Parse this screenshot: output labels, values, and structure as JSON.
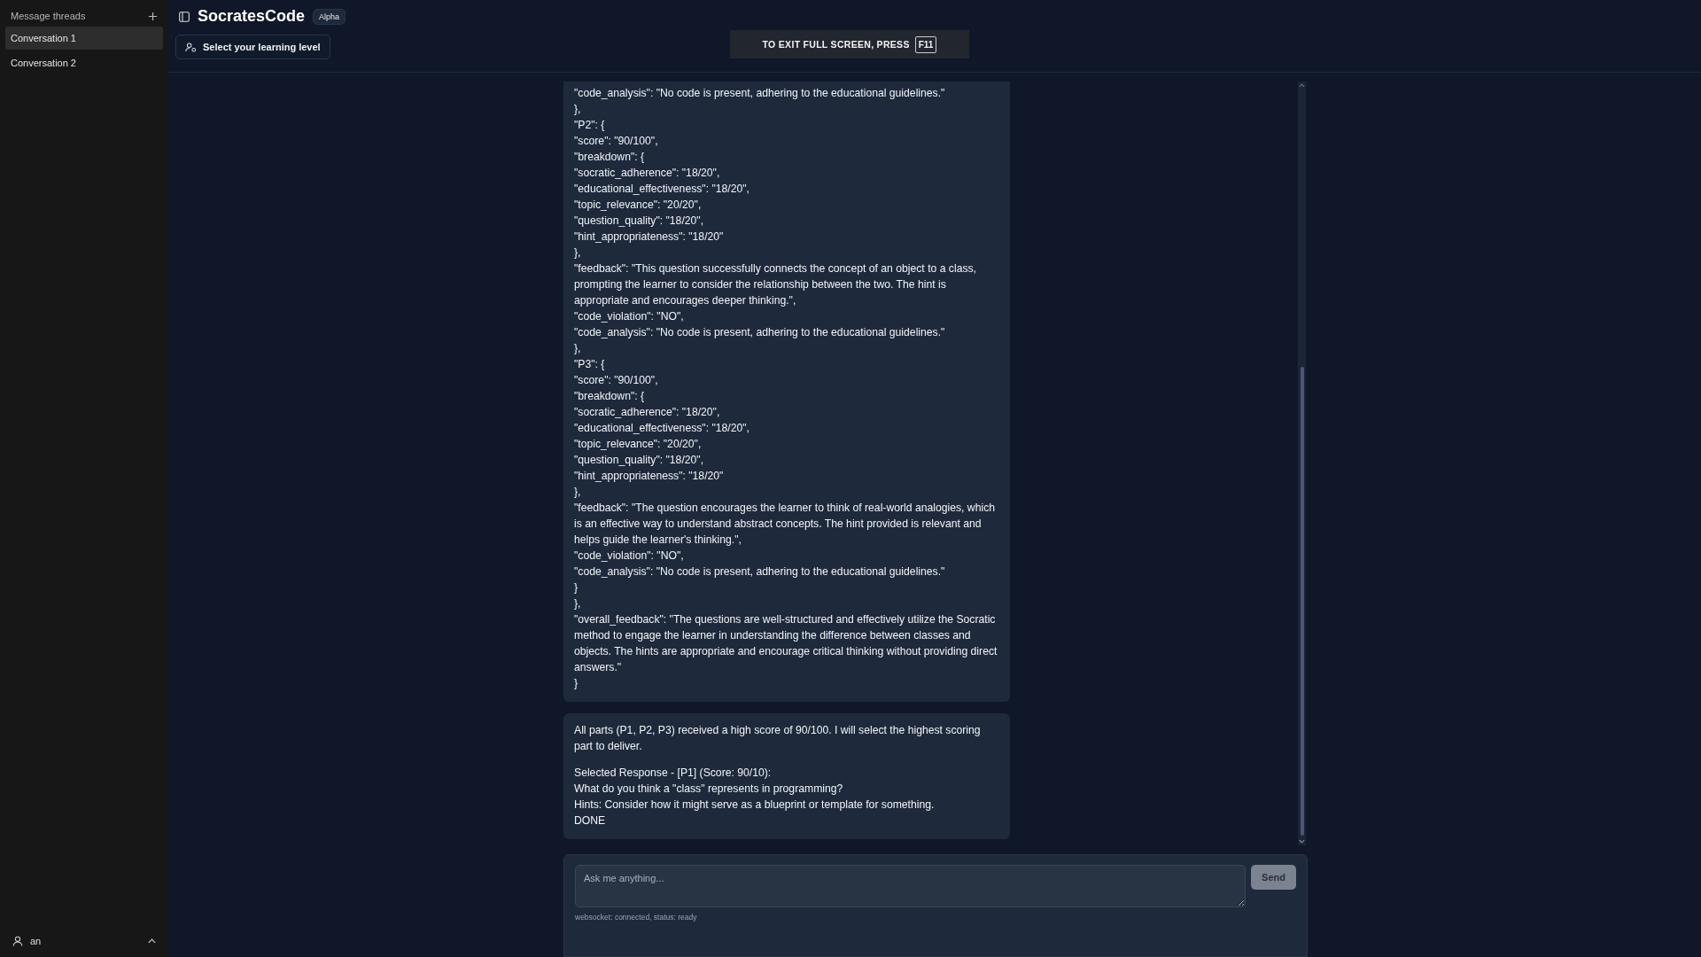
{
  "sidebar": {
    "title": "Message threads",
    "threads": [
      {
        "label": "Conversation 1",
        "selected": true
      },
      {
        "label": "Conversation 2",
        "selected": false
      }
    ],
    "user": {
      "name": "an"
    }
  },
  "header": {
    "app_name": "SocratesCode",
    "badge": "Alpha",
    "level_button": "Select your learning level"
  },
  "fullscreen_notice": {
    "text": "TO EXIT FULL SCREEN, PRESS",
    "key": "F11"
  },
  "messages": [
    {
      "paragraphs": [
        [
          "\"code_analysis\": \"No code is present, adhering to the educational guidelines.\"",
          "},",
          "\"P2\": {",
          "\"score\": \"90/100\",",
          "\"breakdown\": {",
          "\"socratic_adherence\": \"18/20\",",
          "\"educational_effectiveness\": \"18/20\",",
          "\"topic_relevance\": \"20/20\",",
          "\"question_quality\": \"18/20\",",
          "\"hint_appropriateness\": \"18/20\"",
          "},",
          "\"feedback\": \"This question successfully connects the concept of an object to a class, prompting the learner to consider the relationship between the two. The hint is appropriate and encourages deeper thinking.\",",
          "\"code_violation\": \"NO\",",
          "\"code_analysis\": \"No code is present, adhering to the educational guidelines.\"",
          "},",
          "\"P3\": {",
          "\"score\": \"90/100\",",
          "\"breakdown\": {",
          "\"socratic_adherence\": \"18/20\",",
          "\"educational_effectiveness\": \"18/20\",",
          "\"topic_relevance\": \"20/20\",",
          "\"question_quality\": \"18/20\",",
          "\"hint_appropriateness\": \"18/20\"",
          "},",
          "\"feedback\": \"The question encourages the learner to think of real-world analogies, which is an effective way to understand abstract concepts. The hint provided is relevant and helps guide the learner's thinking.\",",
          "\"code_violation\": \"NO\",",
          "\"code_analysis\": \"No code is present, adhering to the educational guidelines.\"",
          "}",
          "},",
          "\"overall_feedback\": \"The questions are well-structured and effectively utilize the Socratic method to engage the learner in understanding the difference between classes and objects. The hints are appropriate and encourage critical thinking without providing direct answers.\"",
          "}"
        ]
      ]
    },
    {
      "paragraphs": [
        [
          "All parts (P1, P2, P3) received a high score of 90/100. I will select the highest scoring part to deliver."
        ],
        [
          "Selected Response - [P1] (Score: 90/10):",
          "What do you think a \"class\" represents in programming?",
          "Hints: Consider how it might serve as a blueprint or template for something.",
          "DONE"
        ]
      ]
    }
  ],
  "composer": {
    "placeholder": "Ask me anything...",
    "send": "Send",
    "status": "websocket: connected, status: ready"
  }
}
